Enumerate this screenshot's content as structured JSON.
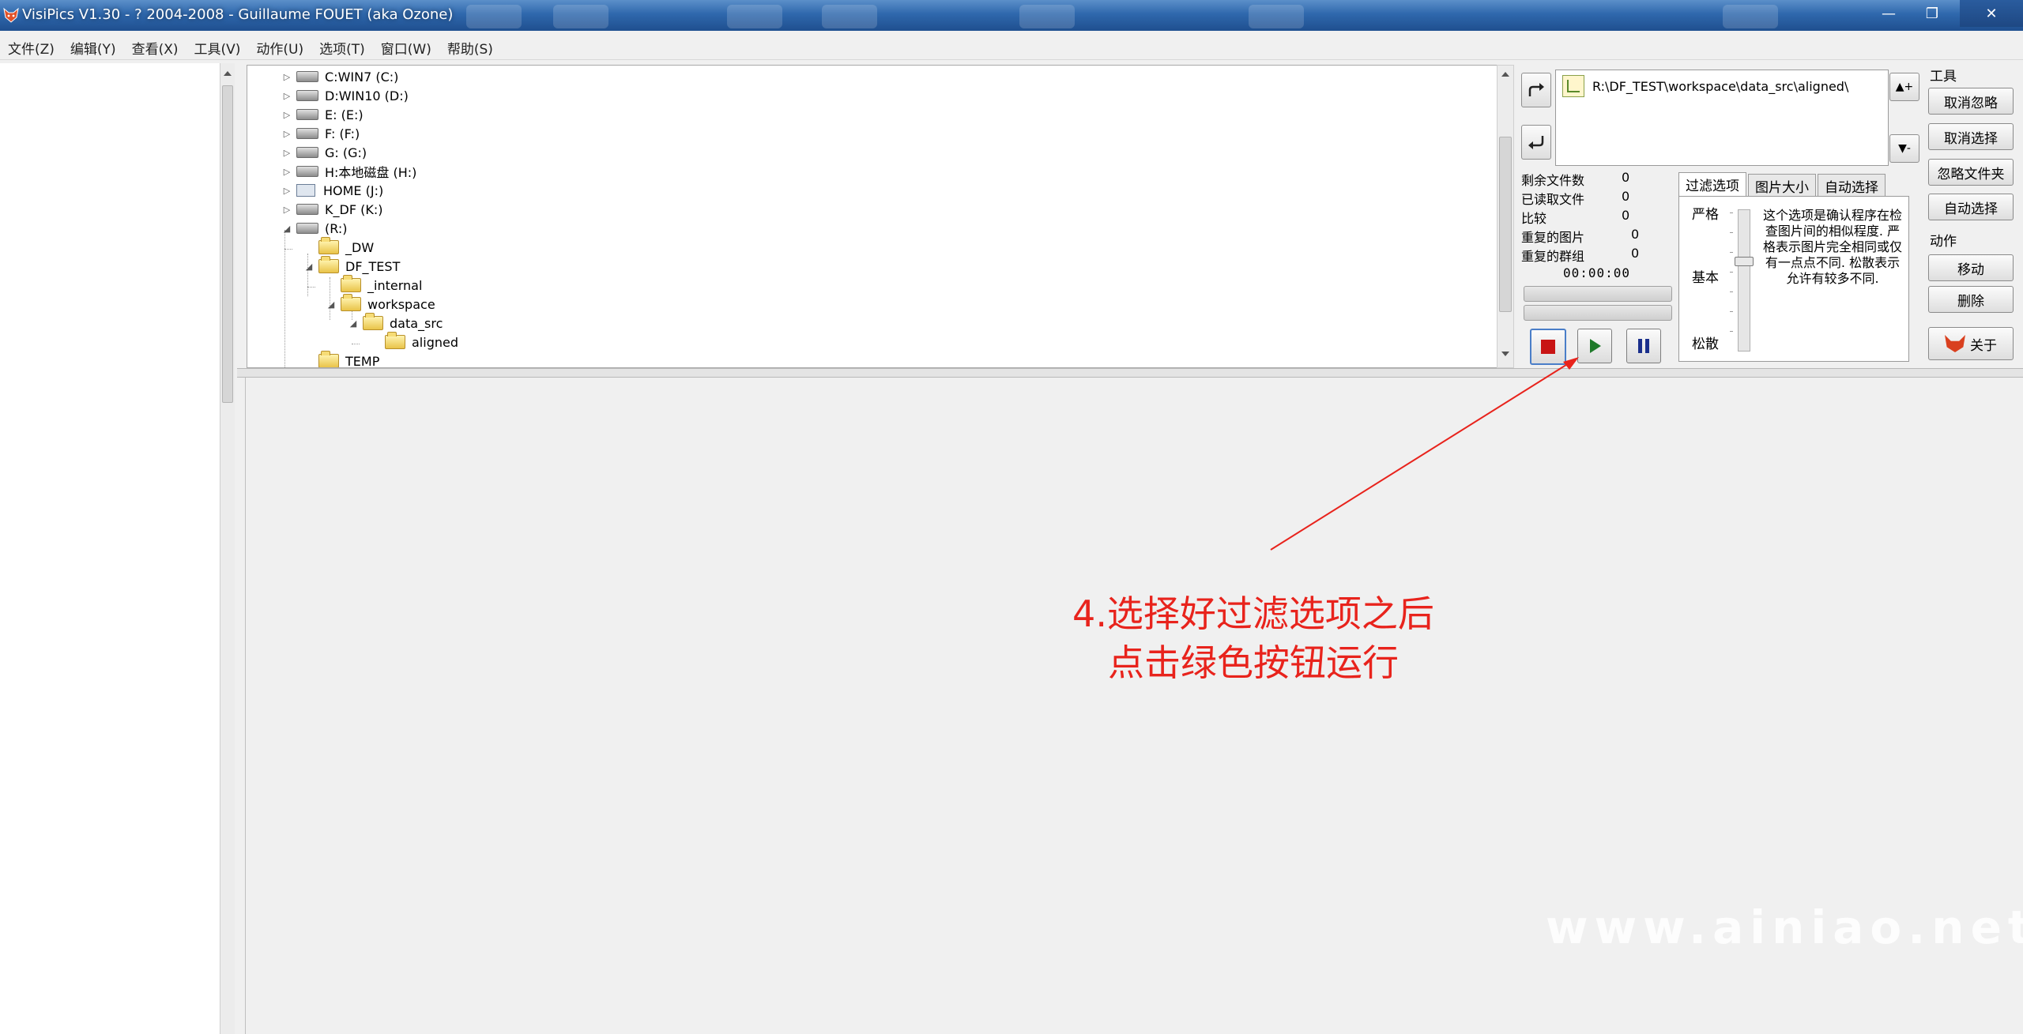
{
  "window": {
    "title": "VisiPics V1.30 - ? 2004-2008 - Guillaume FOUET (aka Ozone)",
    "min_label": "—",
    "max_label": "❐",
    "close_label": "✕"
  },
  "menu": [
    "文件(Z)",
    "编辑(Y)",
    "查看(X)",
    "工具(V)",
    "动作(U)",
    "选项(T)",
    "窗口(W)",
    "帮助(S)"
  ],
  "tree": [
    {
      "label": "C:WIN7 (C:)",
      "kind": "drive",
      "expander": "▷"
    },
    {
      "label": "D:WIN10 (D:)",
      "kind": "drive",
      "expander": "▷"
    },
    {
      "label": "E: (E:)",
      "kind": "drive",
      "expander": "▷"
    },
    {
      "label": "F: (F:)",
      "kind": "drive",
      "expander": "▷"
    },
    {
      "label": "G: (G:)",
      "kind": "drive",
      "expander": "▷"
    },
    {
      "label": "H:本地磁盘 (H:)",
      "kind": "drive",
      "expander": "▷"
    },
    {
      "label": "HOME (J:)",
      "kind": "net",
      "expander": "▷"
    },
    {
      "label": "K_DF (K:)",
      "kind": "drive",
      "expander": "▷"
    },
    {
      "label": "(R:)",
      "kind": "drive",
      "expander": "◢"
    },
    {
      "label": "_DW",
      "kind": "folder",
      "expander": ""
    },
    {
      "label": "DF_TEST",
      "kind": "folder",
      "expander": "◢"
    },
    {
      "label": "_internal",
      "kind": "folder",
      "expander": ""
    },
    {
      "label": "workspace",
      "kind": "folder",
      "expander": "◢"
    },
    {
      "label": "data_src",
      "kind": "folder",
      "expander": "◢"
    },
    {
      "label": "aligned",
      "kind": "folder",
      "expander": ""
    },
    {
      "label": "TEMP",
      "kind": "folder",
      "expander": ""
    }
  ],
  "path": "R:\\DF_TEST\\workspace\\data_src\\aligned\\",
  "path_add_label": "▲+",
  "path_remove_label": "▼-",
  "stats": [
    {
      "label": "剩余文件数",
      "value": "0"
    },
    {
      "label": "已读取文件",
      "value": "0"
    },
    {
      "label": "比较",
      "value": "0"
    },
    {
      "label": "重复的图片",
      "value": "0"
    },
    {
      "label": "重复的群组",
      "value": "0"
    }
  ],
  "timer": "00:00:00",
  "tabs": [
    "过滤选项",
    "图片大小",
    "自动选择"
  ],
  "filter_levels": [
    "严格",
    "基本",
    "松散"
  ],
  "filter_desc": "这个选项是确认程序在检查图片间的相似程度. 严格表示图片完全相同或仅有一点点不同. 松散表示允许有较多不同.",
  "tools_label": "工具",
  "tool_buttons": [
    "取消忽略",
    "取消选择",
    "忽略文件夹",
    "自动选择"
  ],
  "actions_label": "动作",
  "action_buttons": [
    "移动",
    "删除"
  ],
  "about_label": "关于",
  "annotation": [
    "4.选择好过滤选项之后",
    "点击绿色按钮运行"
  ],
  "watermark": "www.ainiao.net",
  "colors": {
    "annotation": "#e8231c",
    "stop": "#c81414",
    "play": "#1f7a2a",
    "pause": "#1a2f8c"
  }
}
